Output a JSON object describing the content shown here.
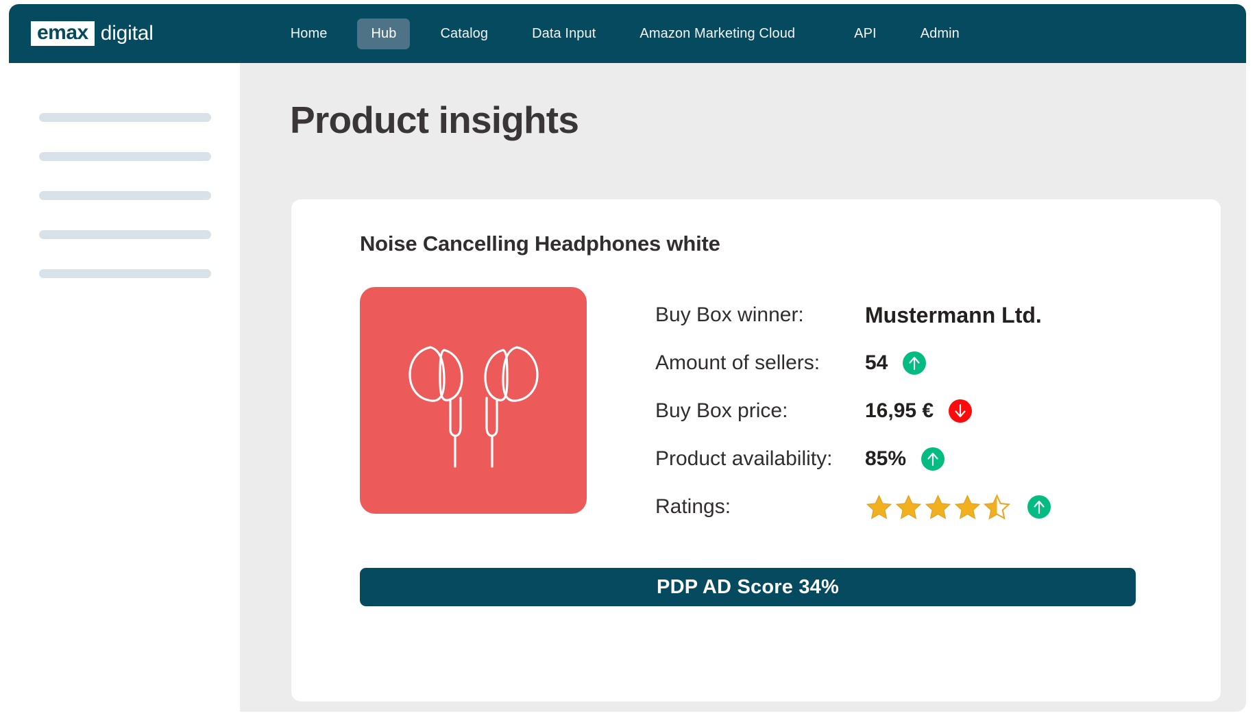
{
  "brand": {
    "logo_mark": "emax",
    "logo_word": "digital",
    "header_color": "#064A60",
    "active_tab_color": "#4E7386"
  },
  "nav": {
    "items": [
      {
        "label": "Home",
        "active": false
      },
      {
        "label": "Hub",
        "active": true
      },
      {
        "label": "Catalog",
        "active": false
      },
      {
        "label": "Data Input",
        "active": false
      },
      {
        "label": "Amazon Marketing Cloud",
        "active": false
      },
      {
        "label": "API",
        "active": false
      },
      {
        "label": "Admin",
        "active": false
      }
    ]
  },
  "sidebar": {
    "placeholder_bars": 5,
    "placeholder_color": "#D9E2E9"
  },
  "page": {
    "title": "Product insights",
    "background": "#ECECEC"
  },
  "product_card": {
    "title": "Noise Cancelling Headphones white",
    "thumbnail": {
      "icon": "earbuds-icon",
      "background": "#EC5B59",
      "stroke": "#FFFFFF"
    },
    "stats": [
      {
        "label": "Buy Box winner:",
        "value": "Mustermann Ltd.",
        "trend": "none"
      },
      {
        "label": "Amount of sellers:",
        "value": "54",
        "trend": "up",
        "trend_icon": "arrow-up-icon"
      },
      {
        "label": "Buy Box price:",
        "value": "16,95 €",
        "trend": "down",
        "trend_icon": "arrow-down-icon"
      },
      {
        "label": "Product availability:",
        "value": "85%",
        "trend": "up",
        "trend_icon": "arrow-up-icon"
      }
    ],
    "ratings": {
      "label": "Ratings:",
      "stars_filled": 4,
      "stars_half": 1,
      "stars_total": 5,
      "value": 4.5,
      "star_color": "#F2B01E",
      "trend": "up",
      "trend_icon": "arrow-up-icon"
    },
    "score_button": {
      "label": "PDP AD Score 34%",
      "score": 34,
      "color": "#064A60"
    }
  },
  "trend_colors": {
    "up": "#04BC82",
    "down": "#FB0B0B"
  }
}
